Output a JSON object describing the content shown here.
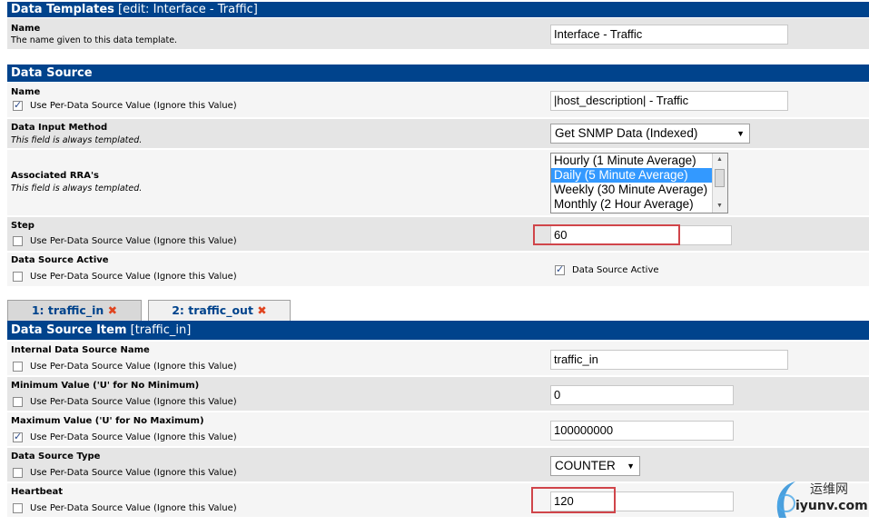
{
  "header_templates": {
    "title": "Data Templates",
    "edit": "[edit: Interface - Traffic]"
  },
  "name_row": {
    "label": "Name",
    "desc": "The name given to this data template.",
    "value": "Interface - Traffic"
  },
  "header_source": {
    "title": "Data Source"
  },
  "ds_name": {
    "label": "Name",
    "checkbox": "Use Per-Data Source Value (Ignore this Value)",
    "checked": true,
    "value": "|host_description| - Traffic"
  },
  "ds_input": {
    "label": "Data Input Method",
    "desc": "This field is always templated.",
    "value": "Get SNMP Data (Indexed)"
  },
  "ds_rra": {
    "label": "Associated RRA's",
    "desc": "This field is always templated.",
    "options": [
      "Hourly (1 Minute Average)",
      "Daily (5 Minute Average)",
      "Weekly (30 Minute Average)",
      "Monthly (2 Hour Average)"
    ],
    "selected": "Daily (5 Minute Average)"
  },
  "ds_step": {
    "label": "Step",
    "checkbox": "Use Per-Data Source Value (Ignore this Value)",
    "checked": false,
    "value": "60"
  },
  "ds_active": {
    "label": "Data Source Active",
    "checkbox": "Use Per-Data Source Value (Ignore this Value)",
    "checked": false,
    "right_checkbox": "Data Source Active",
    "right_checked": true
  },
  "tabs": [
    {
      "label": "1: traffic_in",
      "close": "✖"
    },
    {
      "label": "2: traffic_out",
      "close": "✖"
    }
  ],
  "header_item": {
    "title": "Data Source Item",
    "sub": "[traffic_in]"
  },
  "item_internal": {
    "label": "Internal Data Source Name",
    "checkbox": "Use Per-Data Source Value (Ignore this Value)",
    "checked": false,
    "value": "traffic_in"
  },
  "item_min": {
    "label": "Minimum Value ('U' for No Minimum)",
    "checkbox": "Use Per-Data Source Value (Ignore this Value)",
    "checked": false,
    "value": "0"
  },
  "item_max": {
    "label": "Maximum Value ('U' for No Maximum)",
    "checkbox": "Use Per-Data Source Value (Ignore this Value)",
    "checked": true,
    "value": "100000000"
  },
  "item_type": {
    "label": "Data Source Type",
    "checkbox": "Use Per-Data Source Value (Ignore this Value)",
    "checked": false,
    "value": "COUNTER"
  },
  "item_heartbeat": {
    "label": "Heartbeat",
    "checkbox": "Use Per-Data Source Value (Ignore this Value)",
    "checked": false,
    "value": "120"
  },
  "watermark": {
    "cn": "运维网",
    "en": "iyunv.com"
  },
  "colors": {
    "header_bg": "#00438c",
    "row_a": "#e5e5e5",
    "row_b": "#f5f5f5",
    "highlight": "#d0454a",
    "selected": "#3399ff"
  }
}
